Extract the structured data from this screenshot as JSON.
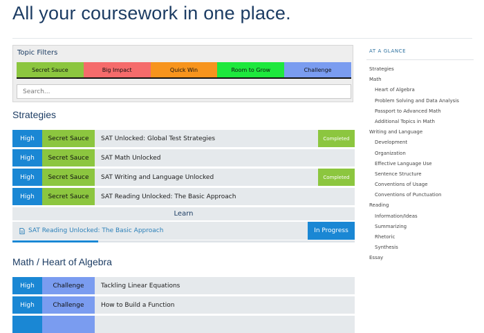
{
  "page": {
    "title": "All your coursework in one place."
  },
  "filters": {
    "title": "Topic Filters",
    "chips": [
      {
        "label": "Secret Sauce",
        "color": "#8cc63f"
      },
      {
        "label": "Big Impact",
        "color": "#f56b6b"
      },
      {
        "label": "Quick Win",
        "color": "#f7941d"
      },
      {
        "label": "Room to Grow",
        "color": "#1ee83d"
      },
      {
        "label": "Challenge",
        "color": "#7a9cf0"
      }
    ],
    "search_placeholder": "Search..."
  },
  "colors": {
    "impact_high": "#1a87d4",
    "secret_sauce": "#8cc63f",
    "challenge": "#7a9cf0",
    "completed": "#8cc63f",
    "in_progress": "#1a87d4"
  },
  "strategies": {
    "title": "Strategies",
    "rows": [
      {
        "impact": "High",
        "topic": "Secret Sauce",
        "title": "SAT Unlocked: Global Test Strategies",
        "status": "Completed"
      },
      {
        "impact": "High",
        "topic": "Secret Sauce",
        "title": "SAT Math Unlocked",
        "status": ""
      },
      {
        "impact": "High",
        "topic": "Secret Sauce",
        "title": "SAT Writing and Language Unlocked",
        "status": "Completed"
      },
      {
        "impact": "High",
        "topic": "Secret Sauce",
        "title": "SAT Reading Unlocked: The Basic Approach",
        "status": ""
      }
    ],
    "learn": {
      "header": "Learn",
      "item_icon": "document-icon",
      "item_title": "SAT Reading Unlocked: The Basic Approach",
      "item_status": "In Progress",
      "progress": 0.25
    }
  },
  "math": {
    "title": "Math / Heart of Algebra",
    "rows": [
      {
        "impact": "High",
        "topic": "Challenge",
        "title": "Tackling Linear Equations"
      },
      {
        "impact": "High",
        "topic": "Challenge",
        "title": "How to Build a Function"
      },
      {
        "impact": "",
        "topic": "",
        "title": ""
      }
    ]
  },
  "sidebar": {
    "heading": "AT A GLANCE",
    "items": [
      {
        "label": "Strategies",
        "level": 0
      },
      {
        "label": "Math",
        "level": 0
      },
      {
        "label": "Heart of Algebra",
        "level": 1
      },
      {
        "label": "Problem Solving and Data Analysis",
        "level": 1
      },
      {
        "label": "Passport to Advanced Math",
        "level": 1
      },
      {
        "label": "Additional Topics in Math",
        "level": 1
      },
      {
        "label": "Writing and Language",
        "level": 0
      },
      {
        "label": "Development",
        "level": 1
      },
      {
        "label": "Organization",
        "level": 1
      },
      {
        "label": "Effective Language Use",
        "level": 1
      },
      {
        "label": "Sentence Structure",
        "level": 1
      },
      {
        "label": "Conventions of Usage",
        "level": 1
      },
      {
        "label": "Conventions of Punctuation",
        "level": 1
      },
      {
        "label": "Reading",
        "level": 0
      },
      {
        "label": "Information/Ideas",
        "level": 1
      },
      {
        "label": "Summarizing",
        "level": 1
      },
      {
        "label": "Rhetoric",
        "level": 1
      },
      {
        "label": "Synthesis",
        "level": 1
      },
      {
        "label": "Essay",
        "level": 0
      }
    ]
  }
}
